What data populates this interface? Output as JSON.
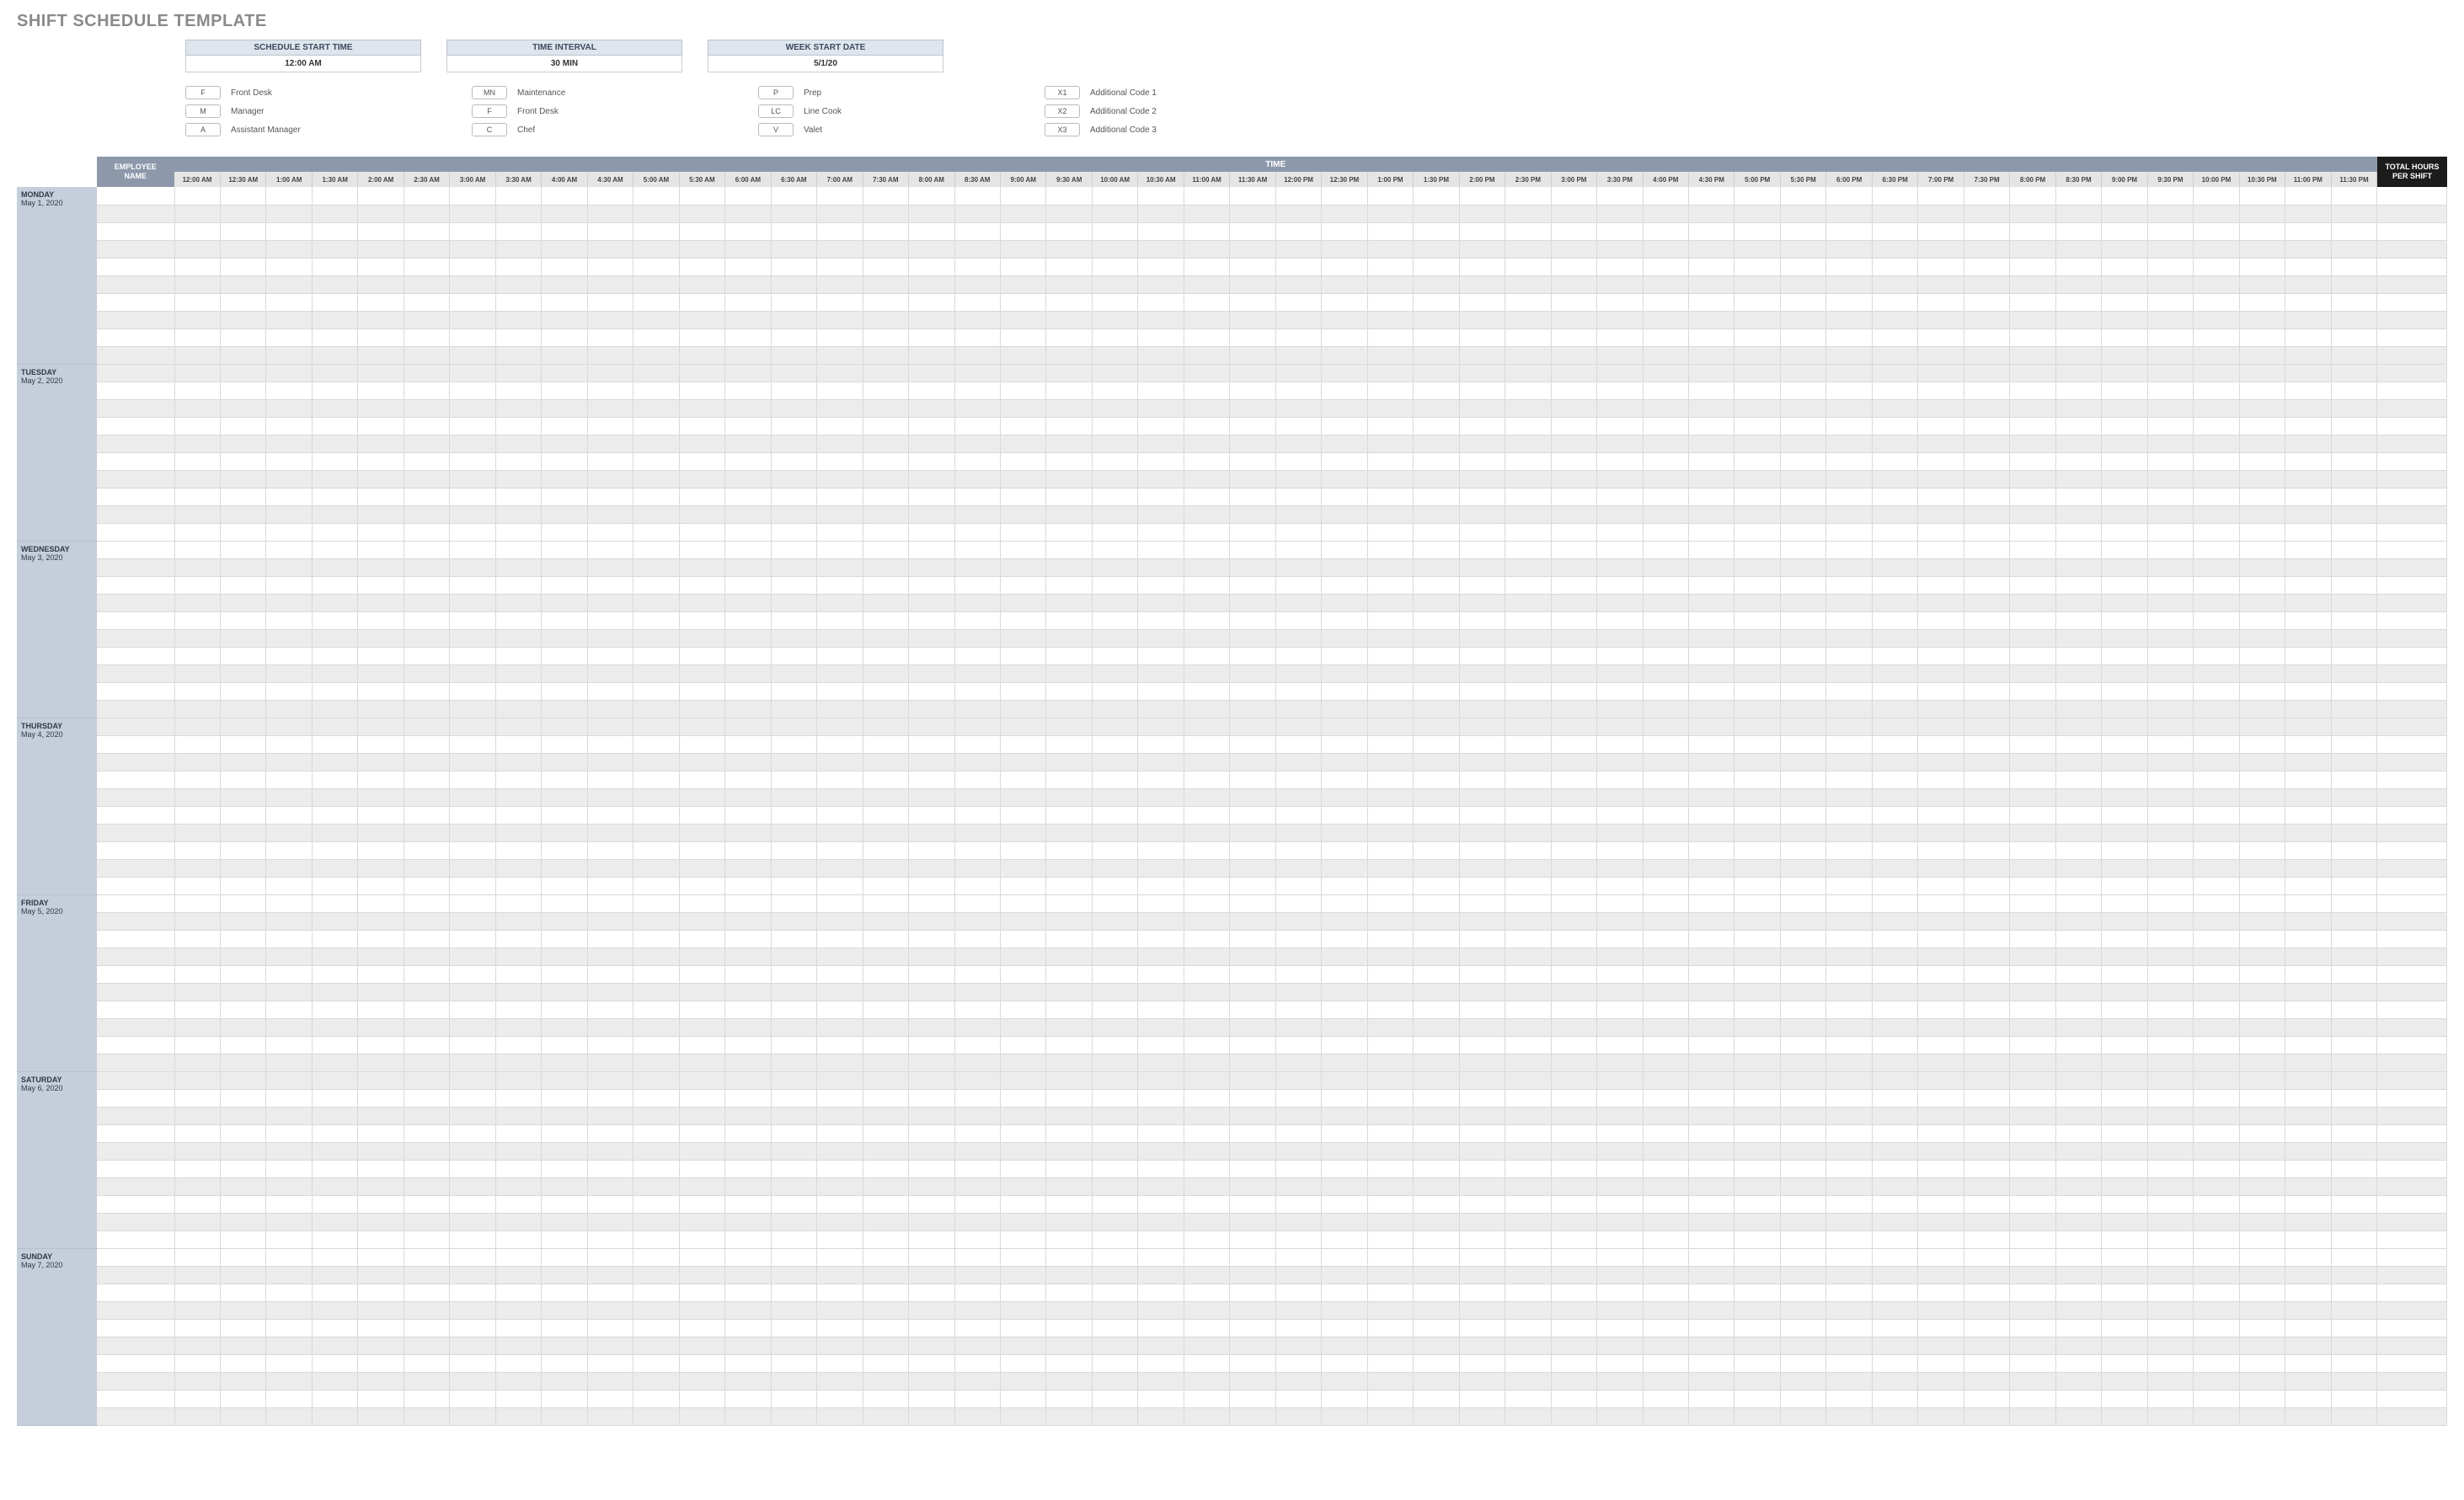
{
  "title": "SHIFT SCHEDULE TEMPLATE",
  "config": {
    "schedule_start_time": {
      "label": "SCHEDULE START TIME",
      "value": "12:00 AM"
    },
    "time_interval": {
      "label": "TIME INTERVAL",
      "value": "30 MIN"
    },
    "week_start_date": {
      "label": "WEEK START DATE",
      "value": "5/1/20"
    }
  },
  "legend": [
    [
      {
        "code": "F",
        "name": "Front Desk"
      },
      {
        "code": "M",
        "name": "Manager"
      },
      {
        "code": "A",
        "name": "Assistant Manager"
      }
    ],
    [
      {
        "code": "MN",
        "name": "Maintenance"
      },
      {
        "code": "F",
        "name": "Front Desk"
      },
      {
        "code": "C",
        "name": "Chef"
      }
    ],
    [
      {
        "code": "P",
        "name": "Prep"
      },
      {
        "code": "LC",
        "name": "Line Cook"
      },
      {
        "code": "V",
        "name": "Valet"
      }
    ],
    [
      {
        "code": "X1",
        "name": "Additional Code 1"
      },
      {
        "code": "X2",
        "name": "Additional Code 2"
      },
      {
        "code": "X3",
        "name": "Additional Code 3"
      }
    ]
  ],
  "headers": {
    "employee": "EMPLOYEE NAME",
    "time": "TIME",
    "total": "TOTAL HOURS PER SHIFT"
  },
  "time_slots": [
    "12:00 AM",
    "12:30 AM",
    "1:00 AM",
    "1:30 AM",
    "2:00 AM",
    "2:30 AM",
    "3:00 AM",
    "3:30 AM",
    "4:00 AM",
    "4:30 AM",
    "5:00 AM",
    "5:30 AM",
    "6:00 AM",
    "6:30 AM",
    "7:00 AM",
    "7:30 AM",
    "8:00 AM",
    "8:30 AM",
    "9:00 AM",
    "9:30 AM",
    "10:00 AM",
    "10:30 AM",
    "11:00 AM",
    "11:30 AM",
    "12:00 PM",
    "12:30 PM",
    "1:00 PM",
    "1:30 PM",
    "2:00 PM",
    "2:30 PM",
    "3:00 PM",
    "3:30 PM",
    "4:00 PM",
    "4:30 PM",
    "5:00 PM",
    "5:30 PM",
    "6:00 PM",
    "6:30 PM",
    "7:00 PM",
    "7:30 PM",
    "8:00 PM",
    "8:30 PM",
    "9:00 PM",
    "9:30 PM",
    "10:00 PM",
    "10:30 PM",
    "11:00 PM",
    "11:30 PM"
  ],
  "days": [
    {
      "name": "MONDAY",
      "date": "May 1, 2020",
      "alt_bg": false,
      "rows": 10
    },
    {
      "name": "TUESDAY",
      "date": "May 2, 2020",
      "alt_bg": true,
      "rows": 10
    },
    {
      "name": "WEDNESDAY",
      "date": "May 3, 2020",
      "alt_bg": false,
      "rows": 10
    },
    {
      "name": "THURSDAY",
      "date": "May 4, 2020",
      "alt_bg": true,
      "rows": 10
    },
    {
      "name": "FRIDAY",
      "date": "May 5, 2020",
      "alt_bg": false,
      "rows": 10
    },
    {
      "name": "SATURDAY",
      "date": "May 6, 2020",
      "alt_bg": true,
      "rows": 10
    },
    {
      "name": "SUNDAY",
      "date": "May 7, 2020",
      "alt_bg": false,
      "rows": 10
    }
  ]
}
